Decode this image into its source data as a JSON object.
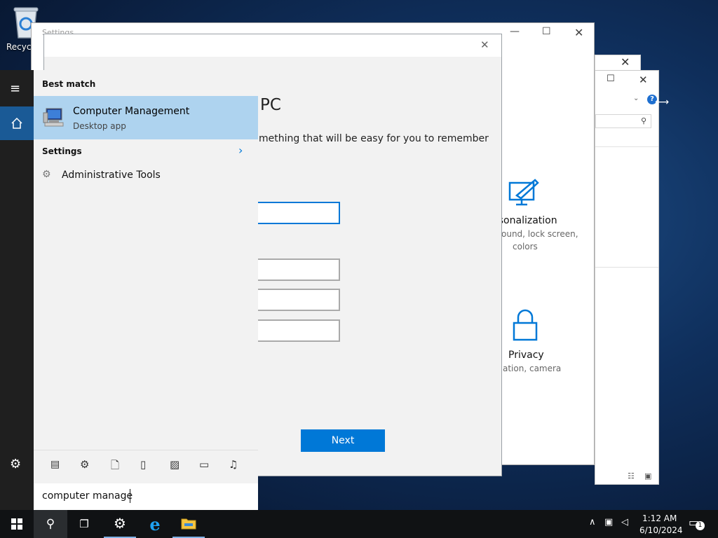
{
  "desktop": {
    "recycle_label": "Recycl"
  },
  "settings_window": {
    "title": "Settings",
    "tiles": [
      {
        "name": "rsonalization",
        "desc_line1": "ound, lock screen,",
        "desc_line2": "colors"
      },
      {
        "name": "Privacy",
        "desc_line1": "ation, camera"
      }
    ]
  },
  "dialog": {
    "heading_partial": "PC",
    "instruction_partial": "mething that will be easy for you to remember",
    "next_label": "Next"
  },
  "start_menu": {
    "best_match_header": "Best match",
    "best_match": {
      "title": "Computer Management",
      "subtitle": "Desktop app"
    },
    "settings_header": "Settings",
    "settings_items": [
      {
        "label": "Administrative Tools"
      }
    ],
    "search_text": "computer manage"
  },
  "taskbar": {
    "time": "1:12 AM",
    "date": "6/10/2024",
    "notification_count": "1"
  },
  "colors": {
    "accent": "#0078d7",
    "selection": "#aed3ef"
  }
}
